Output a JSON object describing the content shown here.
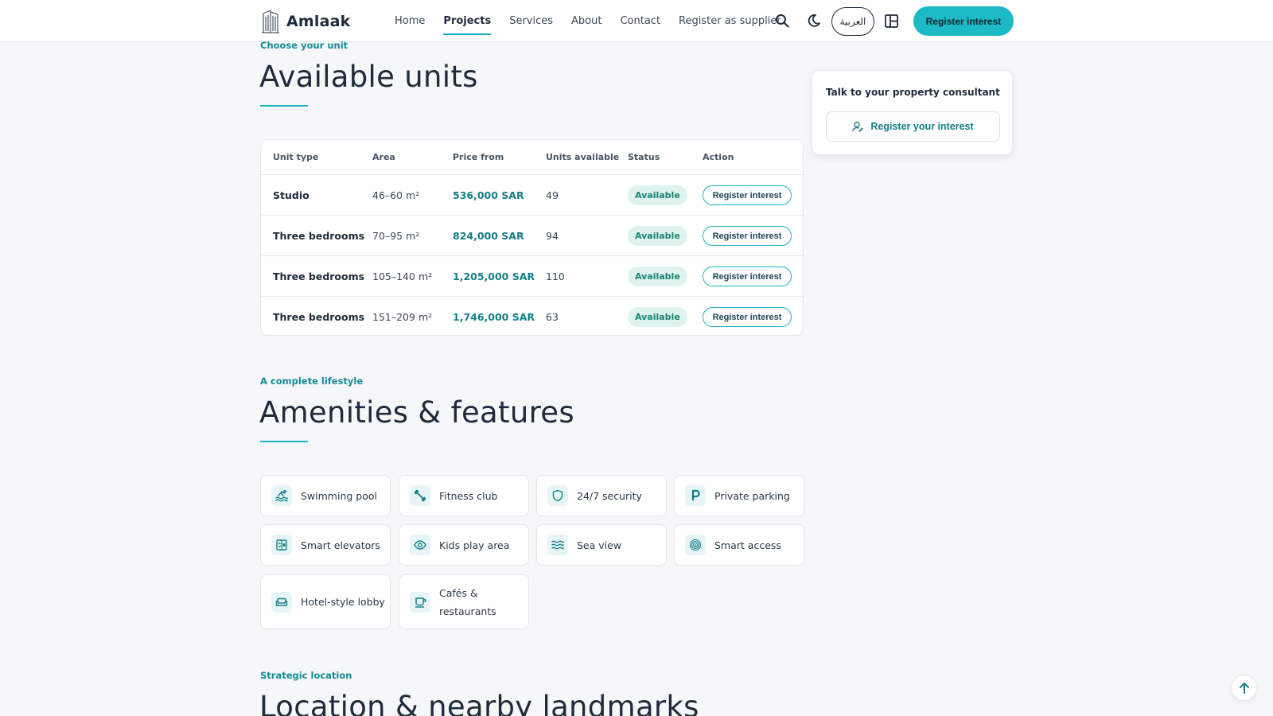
{
  "header": {
    "brand": "Amlaak",
    "nav": [
      {
        "label": "Home",
        "active": false
      },
      {
        "label": "Projects",
        "active": true
      },
      {
        "label": "Services",
        "active": false
      },
      {
        "label": "About",
        "active": false
      },
      {
        "label": "Contact",
        "active": false
      },
      {
        "label": "Register as supplier",
        "active": false
      }
    ],
    "language_label": "العربية",
    "cta_label": "Register interest",
    "accent_color": "#1cbac5"
  },
  "units": {
    "eyebrow": "Choose your unit",
    "title": "Available units",
    "columns": [
      "Unit type",
      "Area",
      "Price from",
      "Units available",
      "Status",
      "Action"
    ],
    "rows": [
      {
        "type": "Studio",
        "area": "46–60 m²",
        "price": "536,000 SAR",
        "available": "49",
        "status": "Available",
        "action": "Register interest"
      },
      {
        "type": "Three bedrooms",
        "area": "70–95 m²",
        "price": "824,000 SAR",
        "available": "94",
        "status": "Available",
        "action": "Register interest"
      },
      {
        "type": "Three bedrooms",
        "area": "105–140 m²",
        "price": "1,205,000 SAR",
        "available": "110",
        "status": "Available",
        "action": "Register interest"
      },
      {
        "type": "Three bedrooms",
        "area": "151–209 m²",
        "price": "1,746,000 SAR",
        "available": "63",
        "status": "Available",
        "action": "Register interest"
      }
    ]
  },
  "consultant": {
    "title": "Talk to your property consultant",
    "button_label": "Register your interest"
  },
  "amenities": {
    "eyebrow": "A complete lifestyle",
    "title": "Amenities & features",
    "items": [
      {
        "label": "Swimming pool",
        "icon": "pool-icon"
      },
      {
        "label": "Fitness club",
        "icon": "dumbbell-icon"
      },
      {
        "label": "24/7 security",
        "icon": "shield-icon"
      },
      {
        "label": "Private parking",
        "icon": "parking-icon"
      },
      {
        "label": "Smart elevators",
        "icon": "elevator-icon"
      },
      {
        "label": "Kids play area",
        "icon": "eye-icon"
      },
      {
        "label": "Sea view",
        "icon": "waves-icon"
      },
      {
        "label": "Smart access",
        "icon": "fingerprint-icon"
      },
      {
        "label": "Hotel-style lobby",
        "icon": "sofa-icon"
      },
      {
        "label": "Cafés & restaurants",
        "icon": "cup-icon"
      }
    ]
  },
  "location": {
    "eyebrow": "Strategic location",
    "title": "Location & nearby landmarks"
  }
}
